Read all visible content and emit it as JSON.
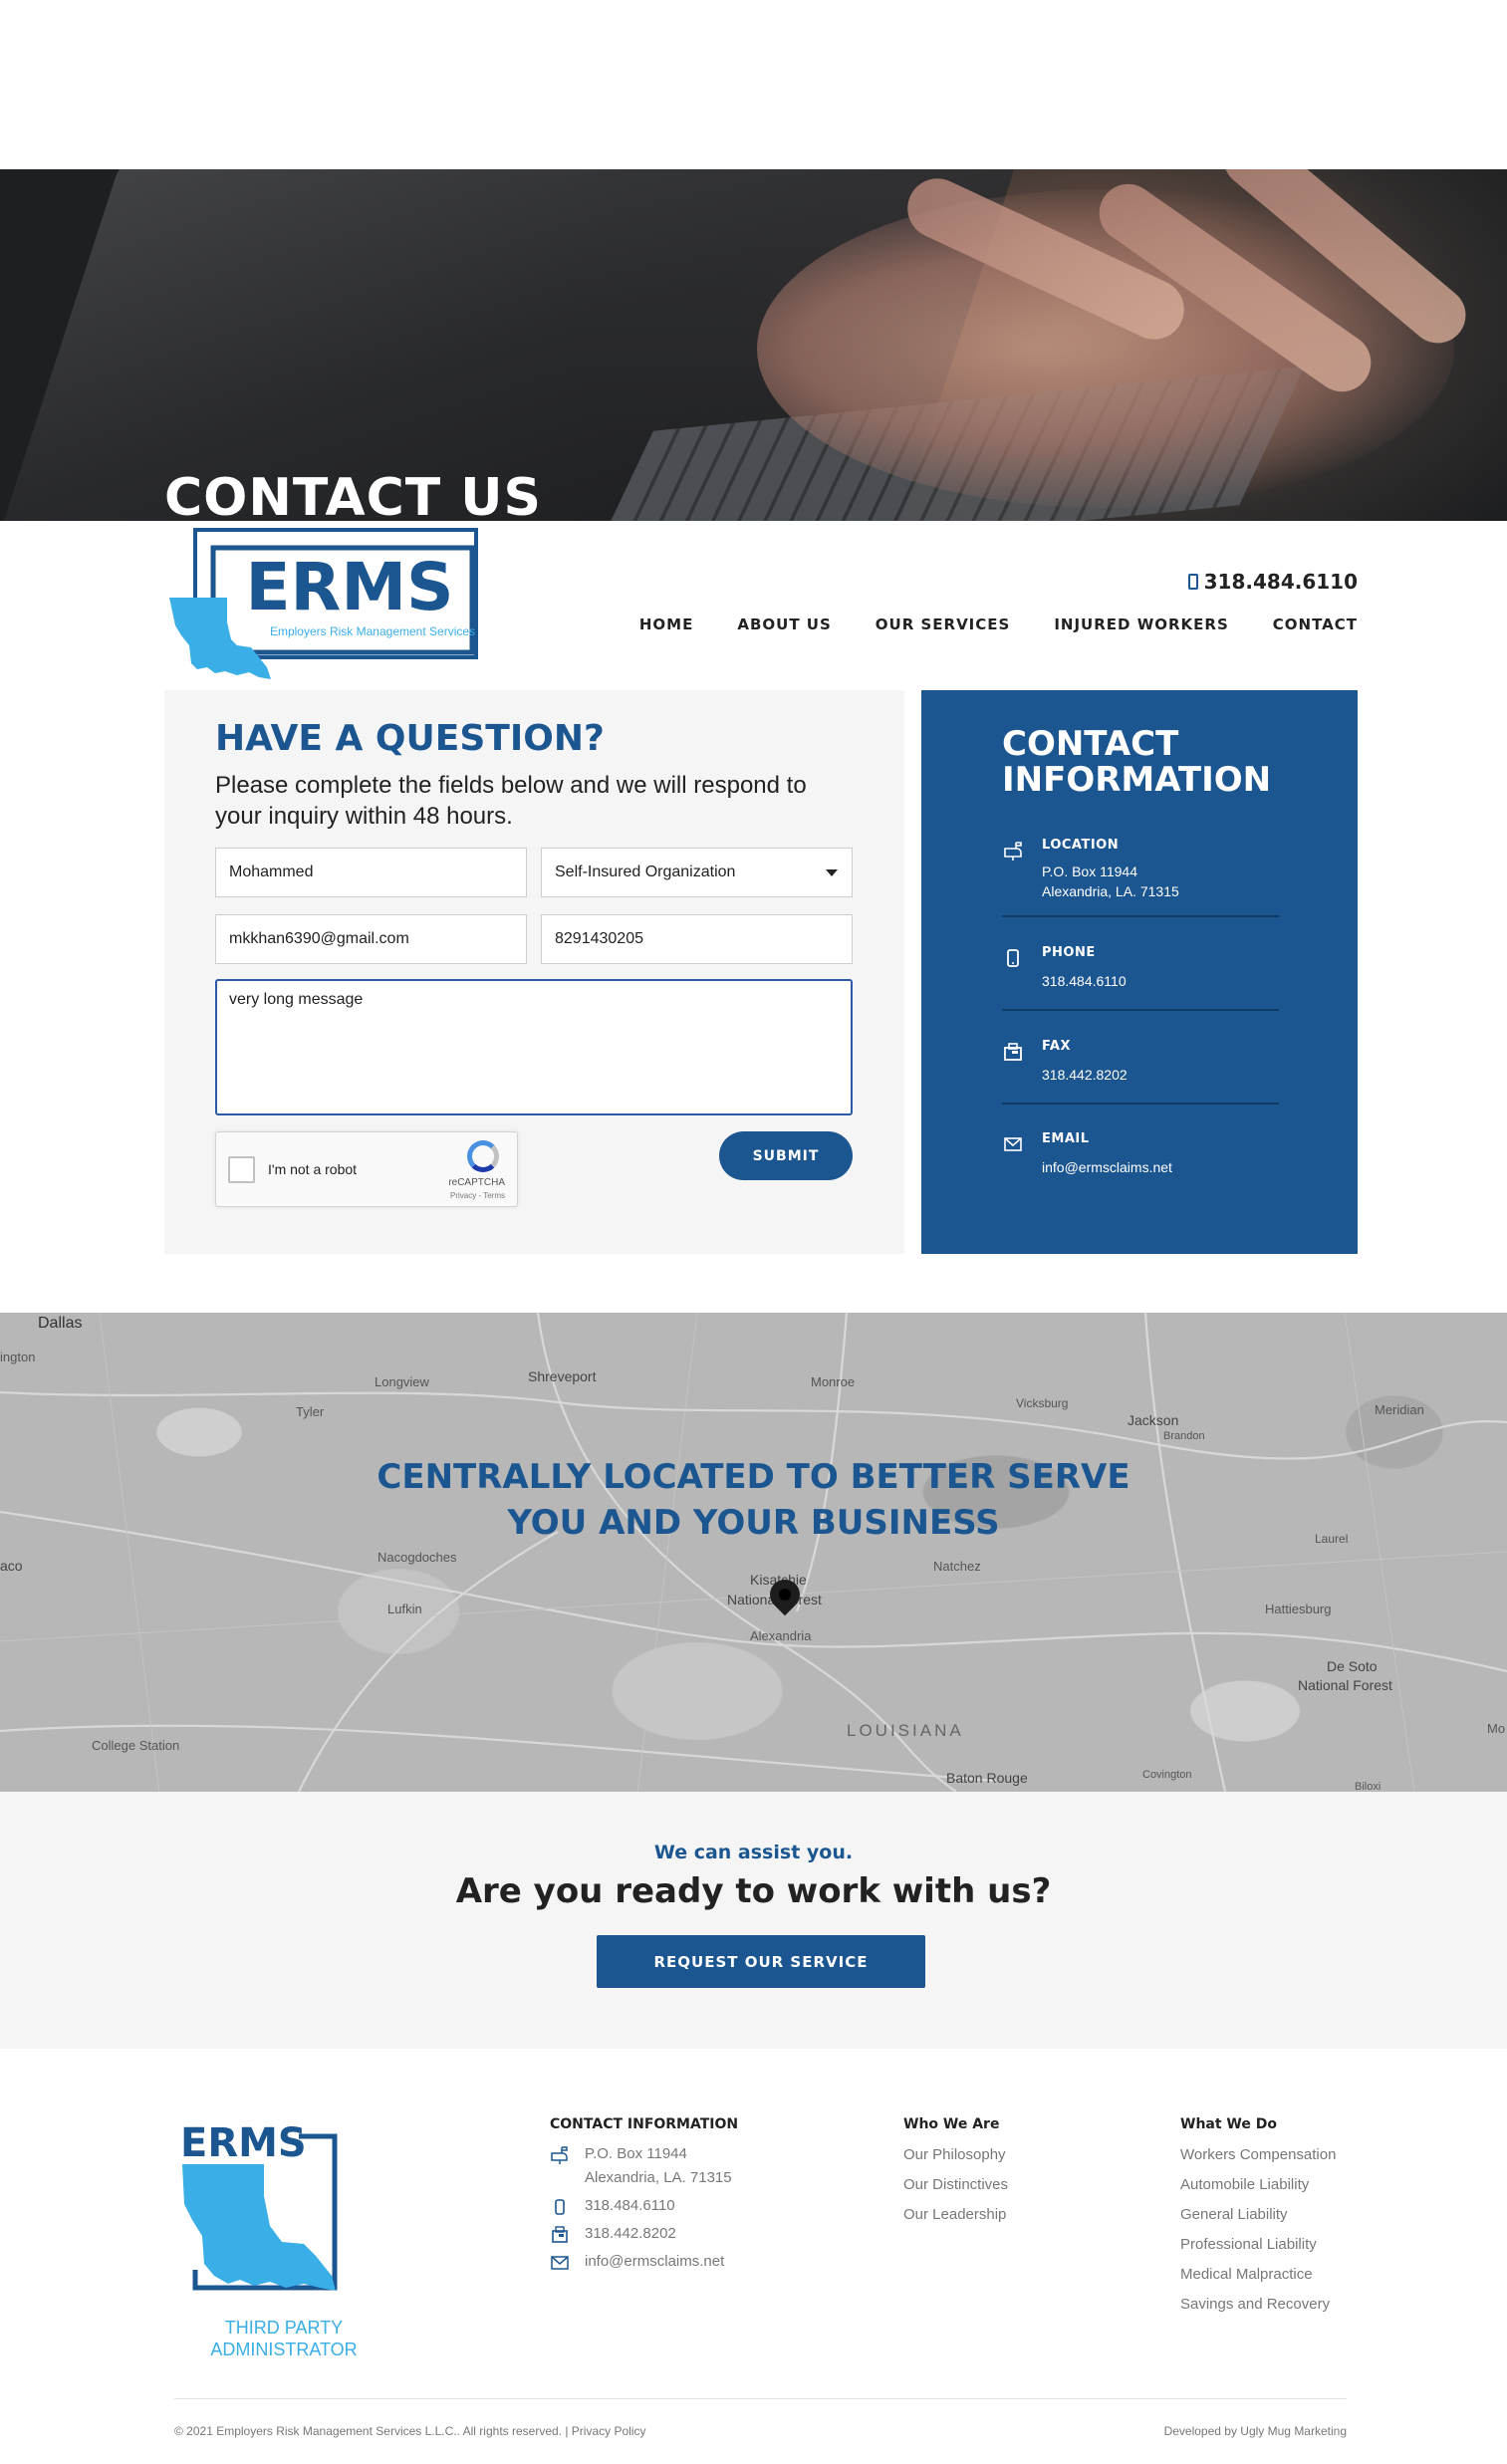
{
  "hero": {
    "title": "CONTACT US"
  },
  "logo": {
    "wordmark": "ERMS",
    "tagline": "Employers Risk Management Services"
  },
  "header": {
    "phone": "318.484.6110",
    "nav": [
      "HOME",
      "ABOUT US",
      "OUR SERVICES",
      "INJURED WORKERS",
      "CONTACT"
    ]
  },
  "form": {
    "title": "HAVE A QUESTION?",
    "subtitle": "Please complete the fields below and we will respond to your inquiry within 48 hours.",
    "name_value": "Mohammed",
    "type_value": "Self-Insured Organization",
    "email_value": "mkkhan6390@gmail.com",
    "phone_value": "8291430205",
    "message_value": "very long message",
    "captcha_label": "I'm not a robot",
    "captcha_brand": "reCAPTCHA",
    "captcha_links": "Privacy - Terms",
    "submit_label": "SUBMIT"
  },
  "contact_info": {
    "title": "CONTACT INFORMATION",
    "location_head": "LOCATION",
    "location_line1": "P.O. Box 11944",
    "location_line2": "Alexandria, LA. 71315",
    "phone_head": "PHONE",
    "phone_value": "318.484.6110",
    "fax_head": "FAX",
    "fax_value": "318.442.8202",
    "email_head": "EMAIL",
    "email_value": "info@ermsclaims.net"
  },
  "map": {
    "title_line1": "CENTRALLY LOCATED TO BETTER SERVE",
    "title_line2": "YOU AND YOUR BUSINESS",
    "labels": [
      "Dallas",
      "ington",
      "Longview",
      "Shreveport",
      "Monroe",
      "Tyler",
      "Vicksburg",
      "Jackson",
      "Brandon",
      "Meridian",
      "Nacogdoches",
      "Natchez",
      "Lufkin",
      "Kisatchie",
      "National Forest",
      "Alexandria",
      "Laurel",
      "Hattiesburg",
      "De Soto",
      "National Forest",
      "aco",
      "College Station",
      "LOUISIANA",
      "Baton Rouge",
      "Covington",
      "Biloxi",
      "Mo"
    ]
  },
  "cta": {
    "kicker": "We can assist you.",
    "title": "Are you ready to work with us?",
    "button": "REQUEST OUR SERVICE"
  },
  "footer": {
    "logo_word": "ERMS",
    "logo_line1": "THIRD PARTY",
    "logo_line2": "ADMINISTRATOR",
    "contact_head": "CONTACT INFORMATION",
    "contact_addr1": "P.O. Box 11944",
    "contact_addr2": "Alexandria, LA. 71315",
    "contact_phone": "318.484.6110",
    "contact_fax": "318.442.8202",
    "contact_email": "info@ermsclaims.net",
    "who_head": "Who We Are",
    "who_links": [
      "Our Philosophy",
      "Our Distinctives",
      "Our Leadership"
    ],
    "what_head": "What We Do",
    "what_links": [
      "Workers Compensation",
      "Automobile Liability",
      "General Liability",
      "Professional Liability",
      "Medical Malpractice",
      "Savings and Recovery"
    ],
    "copyright": "© 2021 Employers Risk Management Services L.L.C.. All rights reserved. | Privacy Policy",
    "developer": "Developed by Ugly Mug Marketing"
  },
  "colors": {
    "brand_blue": "#1c5691",
    "light_blue": "#3aaee6",
    "panel_gray": "#f5f5f5"
  }
}
